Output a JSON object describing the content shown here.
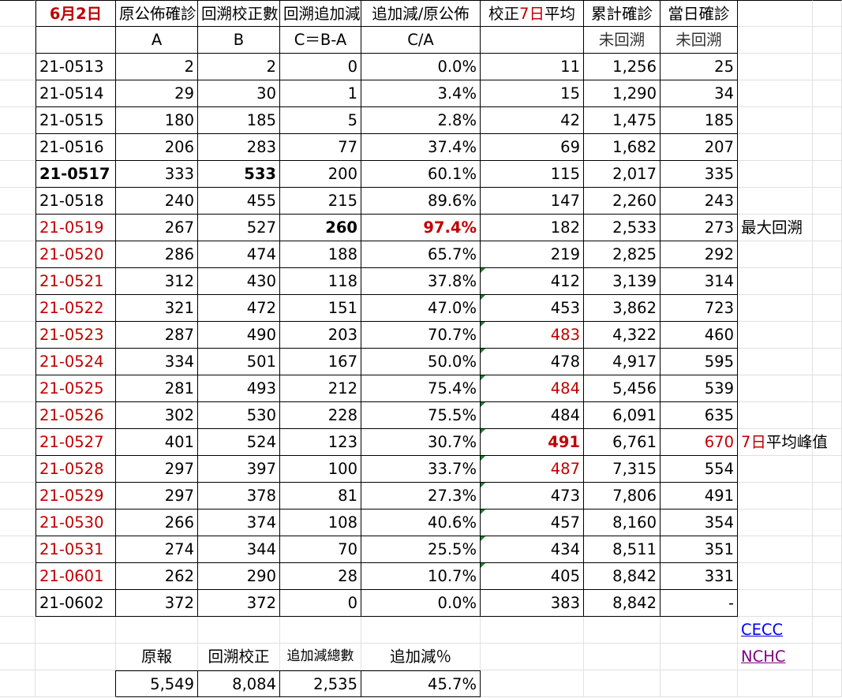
{
  "header": {
    "date_num": "6",
    "date_month": "月",
    "date_day": "2",
    "date_suffix": "日",
    "col_a": "原公佈確診",
    "col_b": "回溯校正數",
    "col_c": "回溯追加減",
    "col_ratio": "追加減/原公佈",
    "col_avg_pre": "校正",
    "col_avg_num": "7日",
    "col_avg_post": "平均",
    "col_cum": "累計確診",
    "col_daily": "當日確診"
  },
  "subheader": {
    "a": "A",
    "b": "B",
    "c": "C＝B-A",
    "ratio": "C/A",
    "cum": "未回溯",
    "daily": "未回溯"
  },
  "rows": [
    {
      "date": "21-0513",
      "a": "2",
      "b": "2",
      "c": "0",
      "ratio": "0.0%",
      "avg": "11",
      "cum": "1,256",
      "daily": "25",
      "note": ""
    },
    {
      "date": "21-0514",
      "a": "29",
      "b": "30",
      "c": "1",
      "ratio": "3.4%",
      "avg": "15",
      "cum": "1,290",
      "daily": "34",
      "note": ""
    },
    {
      "date": "21-0515",
      "a": "180",
      "b": "185",
      "c": "5",
      "ratio": "2.8%",
      "avg": "42",
      "cum": "1,475",
      "daily": "185",
      "note": ""
    },
    {
      "date": "21-0516",
      "a": "206",
      "b": "283",
      "c": "77",
      "ratio": "37.4%",
      "avg": "69",
      "cum": "1,682",
      "daily": "207",
      "note": ""
    },
    {
      "date": "21-0517",
      "a": "333",
      "b": "533",
      "c": "200",
      "ratio": "60.1%",
      "avg": "115",
      "cum": "2,017",
      "daily": "335",
      "note": ""
    },
    {
      "date": "21-0518",
      "a": "240",
      "b": "455",
      "c": "215",
      "ratio": "89.6%",
      "avg": "147",
      "cum": "2,260",
      "daily": "243",
      "note": ""
    },
    {
      "date": "21-0519",
      "a": "267",
      "b": "527",
      "c": "260",
      "ratio": "97.4%",
      "avg": "182",
      "cum": "2,533",
      "daily": "273",
      "note": "最大回溯"
    },
    {
      "date": "21-0520",
      "a": "286",
      "b": "474",
      "c": "188",
      "ratio": "65.7%",
      "avg": "219",
      "cum": "2,825",
      "daily": "292",
      "note": ""
    },
    {
      "date": "21-0521",
      "a": "312",
      "b": "430",
      "c": "118",
      "ratio": "37.8%",
      "avg": "412",
      "cum": "3,139",
      "daily": "314",
      "note": ""
    },
    {
      "date": "21-0522",
      "a": "321",
      "b": "472",
      "c": "151",
      "ratio": "47.0%",
      "avg": "453",
      "cum": "3,862",
      "daily": "723",
      "note": ""
    },
    {
      "date": "21-0523",
      "a": "287",
      "b": "490",
      "c": "203",
      "ratio": "70.7%",
      "avg": "483",
      "cum": "4,322",
      "daily": "460",
      "note": ""
    },
    {
      "date": "21-0524",
      "a": "334",
      "b": "501",
      "c": "167",
      "ratio": "50.0%",
      "avg": "478",
      "cum": "4,917",
      "daily": "595",
      "note": ""
    },
    {
      "date": "21-0525",
      "a": "281",
      "b": "493",
      "c": "212",
      "ratio": "75.4%",
      "avg": "484",
      "cum": "5,456",
      "daily": "539",
      "note": ""
    },
    {
      "date": "21-0526",
      "a": "302",
      "b": "530",
      "c": "228",
      "ratio": "75.5%",
      "avg": "484",
      "cum": "6,091",
      "daily": "635",
      "note": ""
    },
    {
      "date": "21-0527",
      "a": "401",
      "b": "524",
      "c": "123",
      "ratio": "30.7%",
      "avg": "491",
      "cum": "6,761",
      "daily": "670",
      "note_num": "7日",
      "note": "平均峰值"
    },
    {
      "date": "21-0528",
      "a": "297",
      "b": "397",
      "c": "100",
      "ratio": "33.7%",
      "avg": "487",
      "cum": "7,315",
      "daily": "554",
      "note": ""
    },
    {
      "date": "21-0529",
      "a": "297",
      "b": "378",
      "c": "81",
      "ratio": "27.3%",
      "avg": "473",
      "cum": "7,806",
      "daily": "491",
      "note": ""
    },
    {
      "date": "21-0530",
      "a": "266",
      "b": "374",
      "c": "108",
      "ratio": "40.6%",
      "avg": "457",
      "cum": "8,160",
      "daily": "354",
      "note": ""
    },
    {
      "date": "21-0531",
      "a": "274",
      "b": "344",
      "c": "70",
      "ratio": "25.5%",
      "avg": "434",
      "cum": "8,511",
      "daily": "351",
      "note": ""
    },
    {
      "date": "21-0601",
      "a": "262",
      "b": "290",
      "c": "28",
      "ratio": "10.7%",
      "avg": "405",
      "cum": "8,842",
      "daily": "331",
      "note": ""
    },
    {
      "date": "21-0602",
      "a": "372",
      "b": "372",
      "c": "0",
      "ratio": "0.0%",
      "avg": "383",
      "cum": "8,842",
      "daily": "-",
      "note": ""
    }
  ],
  "links": {
    "cecc": "CECC",
    "nchc": "NCHC"
  },
  "summary": {
    "label_orig": "原報",
    "label_corr": "回溯校正",
    "label_total": "追加減總數",
    "label_pct": "追加減％",
    "orig": "5,549",
    "corr": "8,084",
    "total": "2,535",
    "pct": "45.7%"
  },
  "colors": {
    "red_text": "#c00000",
    "link_blue": "#0000ee",
    "link_visited": "#800080",
    "comment_marker": "#1a7f2a"
  }
}
